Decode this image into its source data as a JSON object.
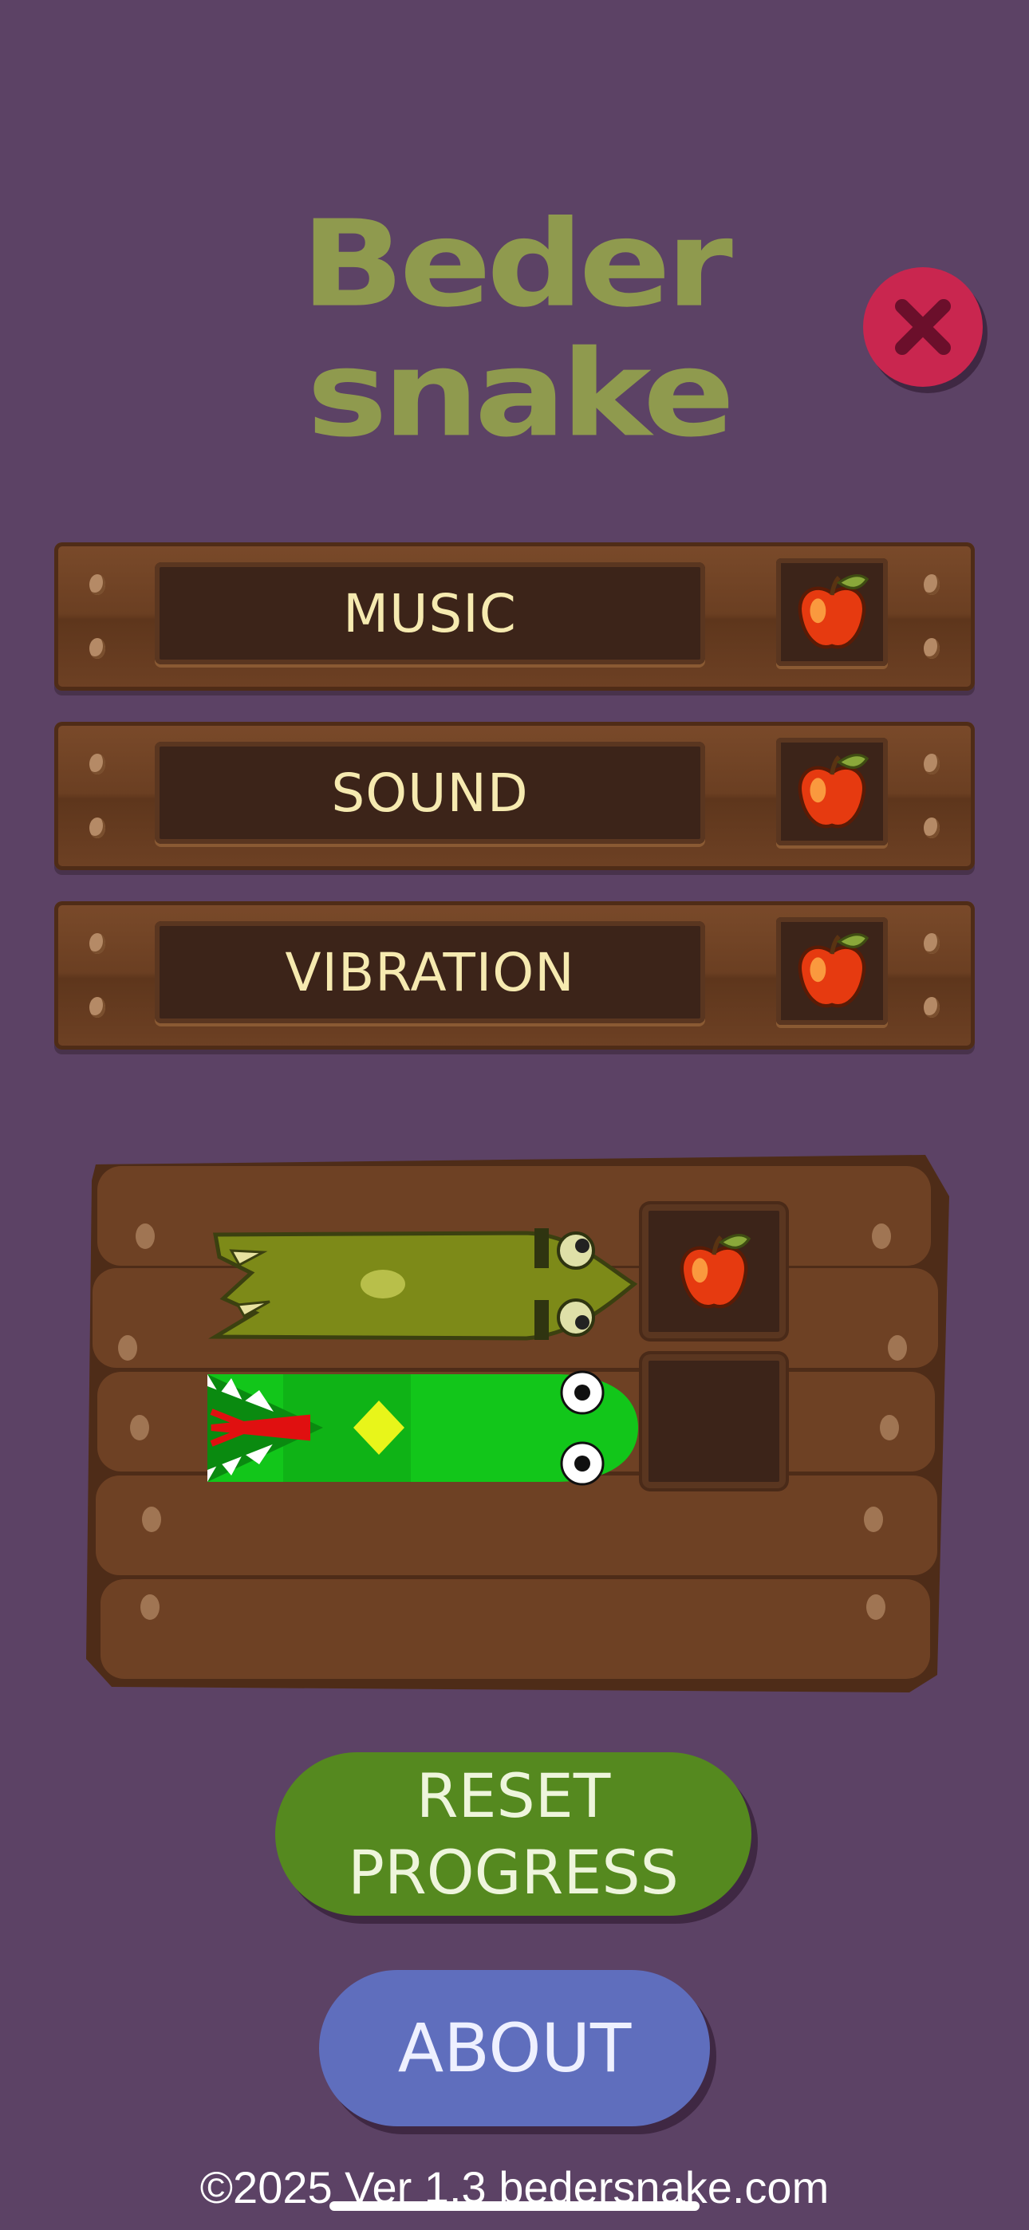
{
  "logo": {
    "line1": "Beder",
    "line2": "snake"
  },
  "colors": {
    "background": "#5c4265",
    "logo": "#8f9a4e",
    "close": "#c9264f",
    "wood": "#6b3f22",
    "reset": "#55891f",
    "about": "#5f6ebd",
    "text_light": "#f6eab0"
  },
  "close_icon": "close-icon",
  "settings": [
    {
      "label": "MUSIC",
      "icon": "apple-icon",
      "enabled": true
    },
    {
      "label": "SOUND",
      "icon": "apple-icon",
      "enabled": true
    },
    {
      "label": "VIBRATION",
      "icon": "apple-icon",
      "enabled": true
    }
  ],
  "skins": [
    {
      "icon": "crocodile-snake-head-icon",
      "selected": true,
      "slot_icon": "apple-icon"
    },
    {
      "icon": "green-snake-head-icon",
      "selected": false,
      "slot_icon": ""
    }
  ],
  "buttons": {
    "reset_line1": "RESET",
    "reset_line2": "PROGRESS",
    "about": "ABOUT"
  },
  "footer": "©2025 Ver 1.3 bedersnake.com"
}
